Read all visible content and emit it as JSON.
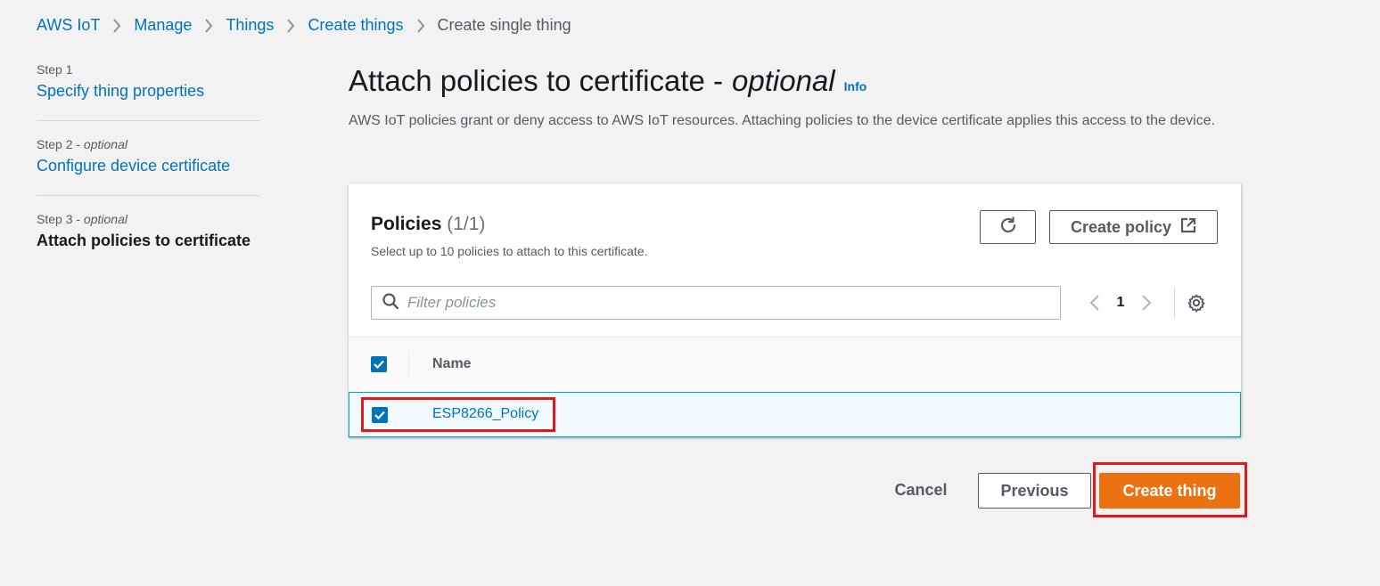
{
  "breadcrumb": {
    "items": [
      "AWS IoT",
      "Manage",
      "Things",
      "Create things"
    ],
    "current": "Create single thing"
  },
  "steps": [
    {
      "label": "Step 1",
      "optional": "",
      "title": "Specify thing properties"
    },
    {
      "label": "Step 2 - ",
      "optional": "optional",
      "title": "Configure device certificate"
    },
    {
      "label": "Step 3 - ",
      "optional": "optional",
      "title": "Attach policies to certificate"
    }
  ],
  "header": {
    "title": "Attach policies to certificate -",
    "title_optional": "optional",
    "info": "Info",
    "description": "AWS IoT policies grant or deny access to AWS IoT resources. Attaching policies to the device certificate applies this access to the device."
  },
  "policies": {
    "title": "Policies",
    "count": "(1/1)",
    "subtitle": "Select up to 10 policies to attach to this certificate.",
    "create_policy_label": "Create policy",
    "filter_placeholder": "Filter policies",
    "page": "1",
    "column_name": "Name",
    "rows": [
      {
        "name": "ESP8266_Policy",
        "selected": true
      }
    ]
  },
  "footer": {
    "cancel": "Cancel",
    "previous": "Previous",
    "create": "Create thing"
  },
  "colors": {
    "link": "#0073bb",
    "primary": "#ec7211",
    "highlight": "#e01a1a"
  }
}
